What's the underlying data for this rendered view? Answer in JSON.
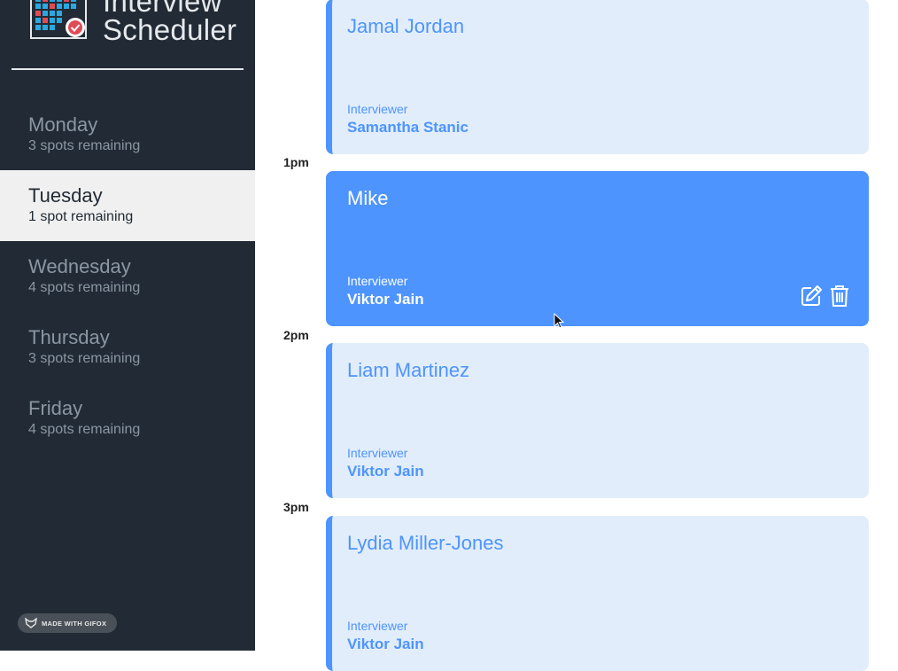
{
  "app": {
    "title_line1": "Interview",
    "title_line2": "Scheduler"
  },
  "sidebar": {
    "days": [
      {
        "name": "Monday",
        "spots": "3 spots remaining",
        "selected": false
      },
      {
        "name": "Tuesday",
        "spots": "1 spot remaining",
        "selected": true
      },
      {
        "name": "Wednesday",
        "spots": "4 spots remaining",
        "selected": false
      },
      {
        "name": "Thursday",
        "spots": "3 spots remaining",
        "selected": false
      },
      {
        "name": "Friday",
        "spots": "4 spots remaining",
        "selected": false
      }
    ],
    "badge": "MADE WITH GIFOX"
  },
  "schedule": {
    "times": [
      "1pm",
      "2pm",
      "3pm"
    ],
    "appointments": [
      {
        "student": "Jamal Jordan",
        "interviewer_label": "Interviewer",
        "interviewer": "Samantha Stanic"
      },
      {
        "student": "Mike",
        "interviewer_label": "Interviewer",
        "interviewer": "Viktor Jain",
        "active": true
      },
      {
        "student": "Liam Martinez",
        "interviewer_label": "Interviewer",
        "interviewer": "Viktor Jain"
      },
      {
        "student": "Lydia Miller-Jones",
        "interviewer_label": "Interviewer",
        "interviewer": "Viktor Jain"
      }
    ],
    "actions": {
      "edit_icon": "edit-icon",
      "delete_icon": "trash-icon"
    }
  },
  "colors": {
    "sidebar_bg": "#222b35",
    "accent": "#4d94ff",
    "appointment_bg": "#e2edfb",
    "selected_day_bg": "#f0f0f0"
  }
}
